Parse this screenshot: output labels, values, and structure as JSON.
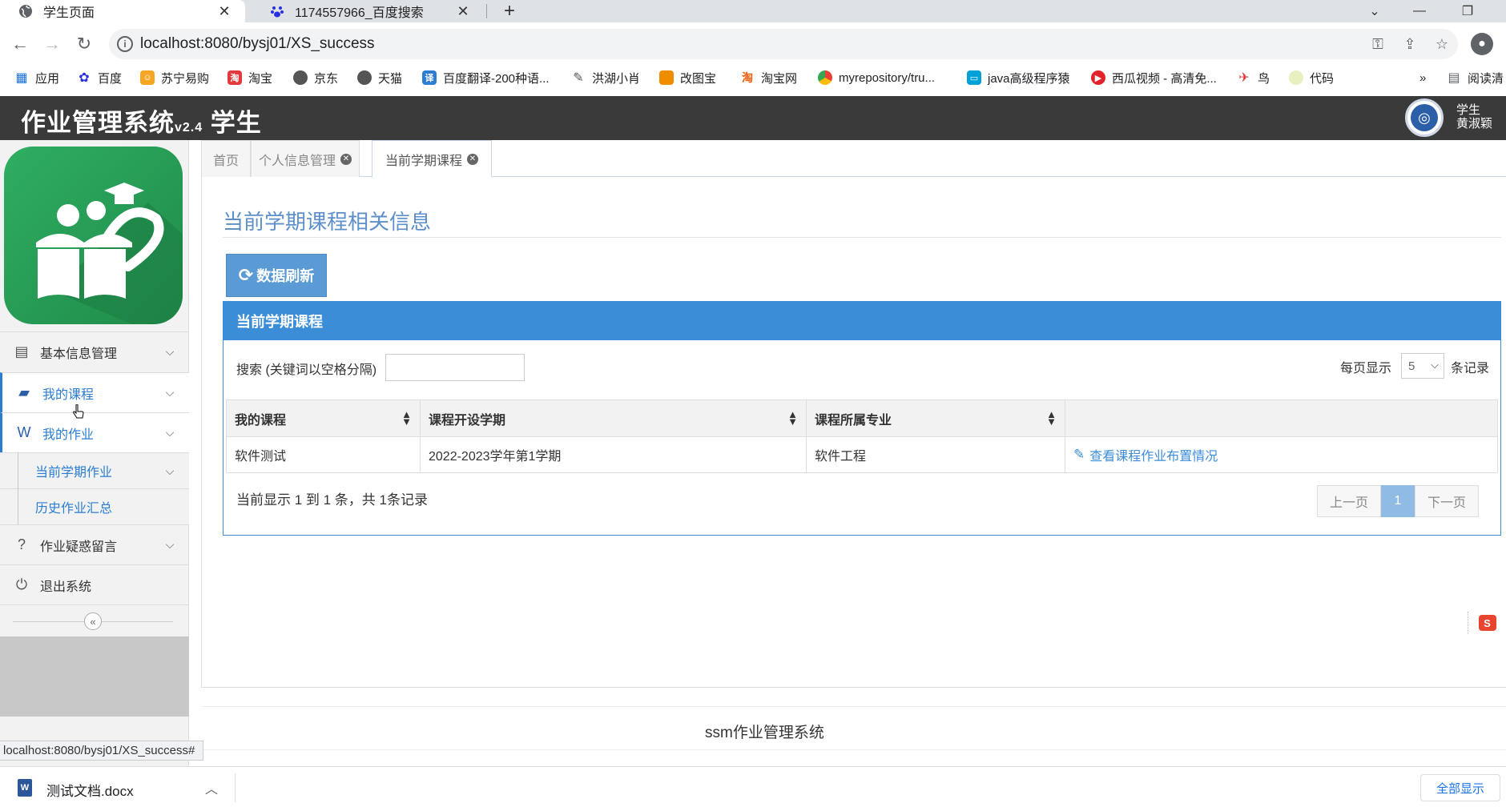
{
  "browser": {
    "tabs": [
      {
        "title": "学生页面",
        "active": true
      },
      {
        "title": "1174557966_百度搜索",
        "active": false
      }
    ],
    "url": "localhost:8080/bysj01/XS_success",
    "bookmarks": [
      "应用",
      "百度",
      "苏宁易购",
      "淘宝",
      "京东",
      "天猫",
      "百度翻译-200种语...",
      "洪湖小肖",
      "改图宝",
      "淘宝网",
      "myrepository/tru...",
      "java高级程序猿",
      "西瓜视频 - 高清免...",
      "鸟",
      "代码"
    ],
    "bookmarks_more": "»",
    "reading_list": "阅读清",
    "status_url": "localhost:8080/bysj01/XS_success#"
  },
  "header": {
    "title": "作业管理系统",
    "version": "v2.4",
    "role_title": "学生",
    "user_role": "学生",
    "user_name": "黄淑颖"
  },
  "sidebar": {
    "items": [
      {
        "label": "基本信息管理",
        "icon": "id-card-icon"
      },
      {
        "label": "我的课程",
        "icon": "book-icon"
      },
      {
        "label": "我的作业",
        "icon": "word-doc-icon"
      },
      {
        "label": "作业疑惑留言",
        "icon": "question-circle-icon"
      },
      {
        "label": "退出系统",
        "icon": "power-icon"
      }
    ],
    "sub_items": [
      {
        "label": "当前学期作业"
      },
      {
        "label": "历史作业汇总"
      }
    ]
  },
  "content_tabs": [
    {
      "label": "首页"
    },
    {
      "label": "个人信息管理"
    },
    {
      "label": "当前学期课程"
    }
  ],
  "main": {
    "heading": "当前学期课程相关信息",
    "refresh_label": "数据刷新",
    "panel_title": "当前学期课程",
    "search_label": "搜索 (关键词以空格分隔)",
    "search_value": "",
    "perpage_label": "每页显示",
    "perpage_value": "5",
    "perpage_suffix": "条记录",
    "table": {
      "columns": [
        "我的课程",
        "课程开设学期",
        "课程所属专业",
        ""
      ],
      "rows": [
        {
          "course": "软件测试",
          "term": "2022-2023学年第1学期",
          "major": "软件工程",
          "action": "查看课程作业布置情况"
        }
      ]
    },
    "info": "当前显示 1 到 1 条，共 1条记录",
    "pager": {
      "prev": "上一页",
      "current": "1",
      "next": "下一页"
    }
  },
  "footer": {
    "text": "ssm作业管理系统"
  },
  "downloads": {
    "file_name": "测试文档.docx",
    "show_all": "全部显示"
  },
  "colors": {
    "header_bg": "#3a3a3a",
    "accent": "#3c8dd8",
    "link": "#2b7dd1",
    "logo_green": "#2fae62"
  }
}
